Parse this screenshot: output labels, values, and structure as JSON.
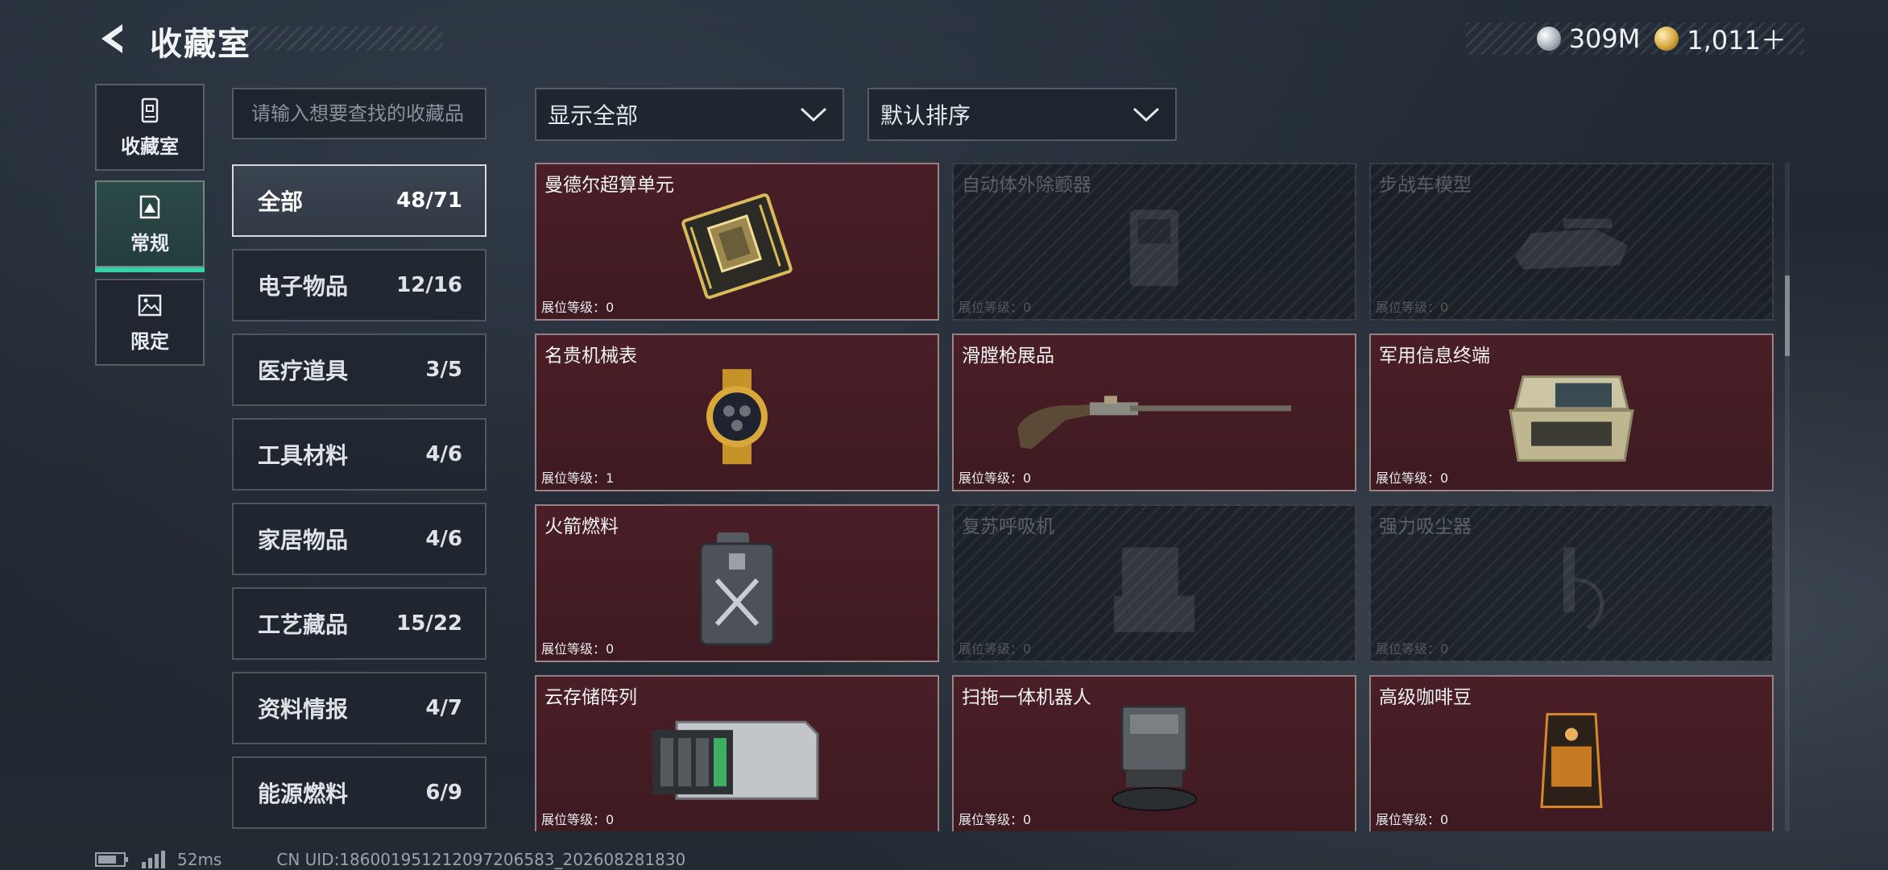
{
  "header": {
    "title": "收藏室",
    "currency_silver": "309M",
    "currency_gold": "1,011＋"
  },
  "nav": [
    {
      "label": "收藏室",
      "icon": "archive-icon",
      "active": false
    },
    {
      "label": "常规",
      "icon": "gallery-icon",
      "active": true
    },
    {
      "label": "限定",
      "icon": "landscape-icon",
      "active": false
    }
  ],
  "search": {
    "placeholder": "请输入想要查找的收藏品",
    "value": ""
  },
  "categories": [
    {
      "label": "全部",
      "count": "48/71",
      "active": true
    },
    {
      "label": "电子物品",
      "count": "12/16",
      "active": false
    },
    {
      "label": "医疗道具",
      "count": "3/5",
      "active": false
    },
    {
      "label": "工具材料",
      "count": "4/6",
      "active": false
    },
    {
      "label": "家居物品",
      "count": "4/6",
      "active": false
    },
    {
      "label": "工艺藏品",
      "count": "15/22",
      "active": false
    },
    {
      "label": "资料情报",
      "count": "4/7",
      "active": false
    },
    {
      "label": "能源燃料",
      "count": "6/9",
      "active": false
    }
  ],
  "filters": {
    "display": "显示全部",
    "sort": "默认排序"
  },
  "items": [
    {
      "name": "曼德尔超算单元",
      "level_label": "展位等级：",
      "level": "0",
      "owned": true,
      "icon": "cpu-board-icon"
    },
    {
      "name": "自动体外除颤器",
      "level_label": "展位等级：",
      "level": "0",
      "owned": false,
      "icon": "defibrillator-icon"
    },
    {
      "name": "步战车模型",
      "level_label": "展位等级：",
      "level": "0",
      "owned": false,
      "icon": "tank-model-icon"
    },
    {
      "name": "名贵机械表",
      "level_label": "展位等级：",
      "level": "1",
      "owned": true,
      "icon": "watch-icon"
    },
    {
      "name": "滑膛枪展品",
      "level_label": "展位等级：",
      "level": "0",
      "owned": true,
      "icon": "musket-icon"
    },
    {
      "name": "军用信息终端",
      "level_label": "展位等级：",
      "level": "0",
      "owned": true,
      "icon": "terminal-case-icon"
    },
    {
      "name": "火箭燃料",
      "level_label": "展位等级：",
      "level": "0",
      "owned": true,
      "icon": "fuel-can-icon"
    },
    {
      "name": "复苏呼吸机",
      "level_label": "展位等级：",
      "level": "0",
      "owned": false,
      "icon": "ventilator-icon"
    },
    {
      "name": "强力吸尘器",
      "level_label": "展位等级：",
      "level": "0",
      "owned": false,
      "icon": "vacuum-icon"
    },
    {
      "name": "云存储阵列",
      "level_label": "展位等级：",
      "level": "0",
      "owned": true,
      "icon": "storage-array-icon"
    },
    {
      "name": "扫拖一体机器人",
      "level_label": "展位等级：",
      "level": "0",
      "owned": true,
      "icon": "robot-vacuum-icon"
    },
    {
      "name": "高级咖啡豆",
      "level_label": "展位等级：",
      "level": "0",
      "owned": true,
      "icon": "coffee-bag-icon"
    }
  ],
  "footer": {
    "latency": "52ms",
    "uid": "CN UID:18600195121209720​6583_202608281830"
  }
}
